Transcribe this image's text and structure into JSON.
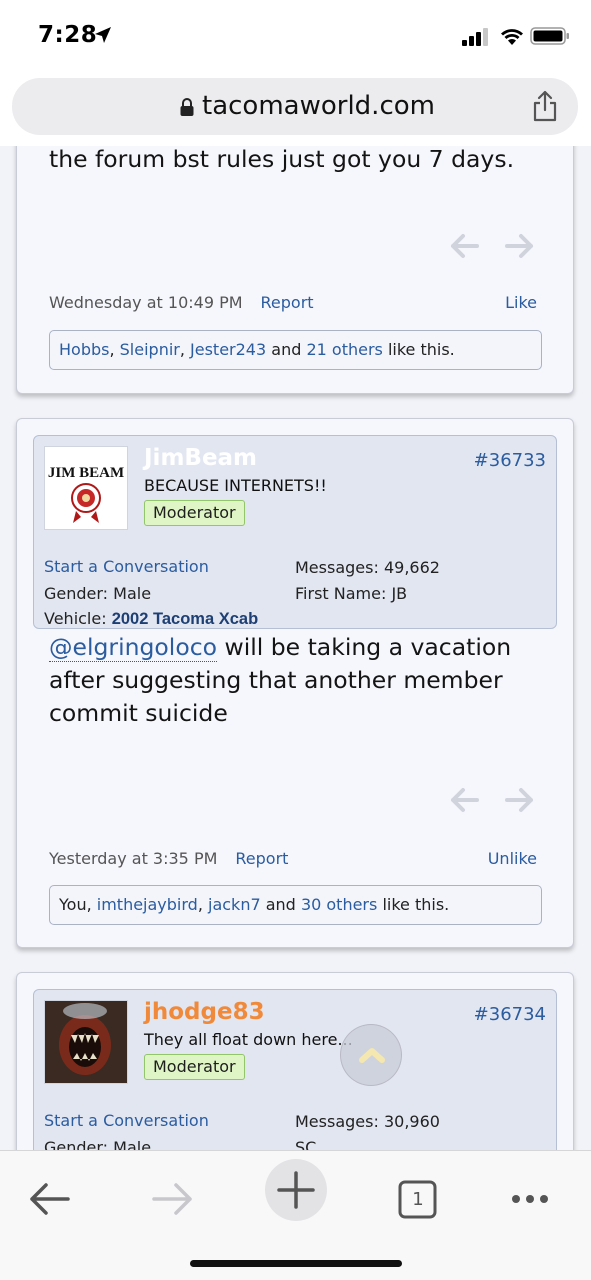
{
  "status_bar": {
    "time": "7:28"
  },
  "browser": {
    "url": "tacomaworld.com",
    "tab_count": "1"
  },
  "posts": [
    {
      "text": "the forum bst rules just got you 7 days.",
      "timestamp": "Wednesday at 10:49 PM",
      "report_label": "Report",
      "like_label": "Like",
      "likes": {
        "users": [
          "Hobbs",
          "Sleipnir",
          "Jester243"
        ],
        "and_text": "and",
        "others": "21 others",
        "suffix": "like this."
      }
    },
    {
      "username": "JimBeam",
      "user_title": "BECAUSE INTERNETS!!",
      "role": "Moderator",
      "post_number": "#36733",
      "avatar_text": "JIM BEAM",
      "start_conversation": "Start a Conversation",
      "fields": {
        "gender_label": "Gender:",
        "gender": "Male",
        "vehicle_label": "Vehicle:",
        "vehicle": "2002 Tacoma Xcab",
        "messages_label": "Messages:",
        "messages": "49,662",
        "first_name_label": "First Name:",
        "first_name": "JB"
      },
      "mention": "@elgringoloco",
      "text_line1_rest": " will be taking a vacation",
      "text_line2": "after suggesting that another member",
      "text_line3": "commit suicide",
      "timestamp": "Yesterday at 3:35 PM",
      "report_label": "Report",
      "like_label": "Unlike",
      "likes": {
        "first": "You,",
        "users": [
          "imthejaybird",
          "jackn7"
        ],
        "and_text": "and",
        "others": "30 others",
        "suffix": "like this."
      }
    },
    {
      "username": "jhodge83",
      "user_title": "They all float down here...",
      "role": "Moderator",
      "post_number": "#36734",
      "start_conversation": "Start a Conversation",
      "fields": {
        "gender_label": "Gender:",
        "gender": "Male",
        "messages_label": "Messages:",
        "messages": "30,960",
        "state": "SC"
      }
    }
  ],
  "colors": {
    "link": "#2b5c9f",
    "jimbeam_name": "#ffffff",
    "jhodge_name": "#f08a3a",
    "moderator_badge": "#dff5c6"
  }
}
